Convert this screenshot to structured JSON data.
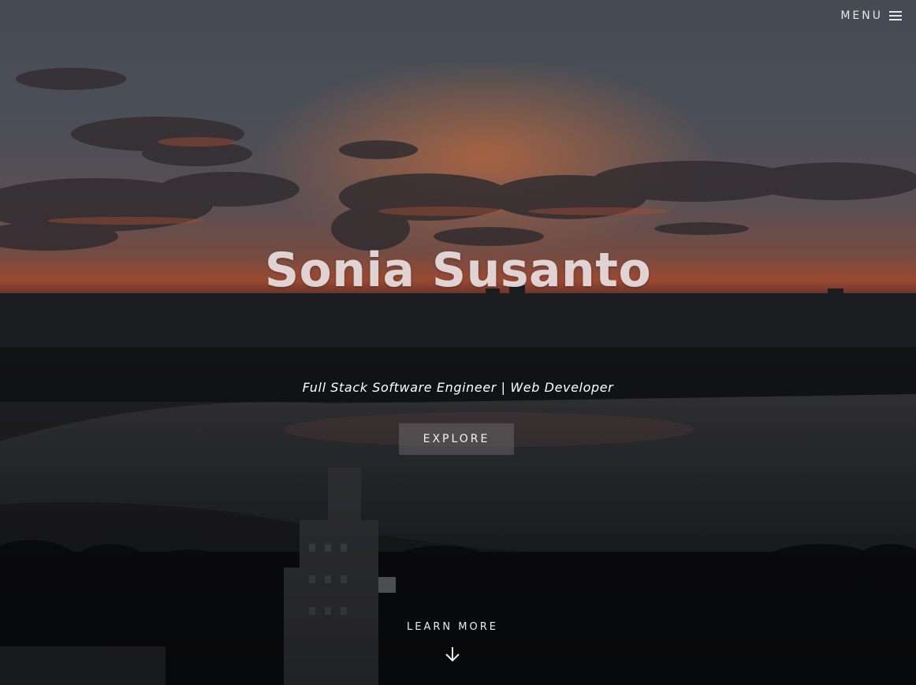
{
  "header": {
    "menu_label": "MENU",
    "menu_icon": "hamburger-icon"
  },
  "hero": {
    "title": "Sonia Susanto",
    "subtitle": "Full Stack Software Engineer | Web Developer",
    "explore_label": "EXPLORE",
    "learn_more_label": "LEARN MORE",
    "learn_more_icon": "arrow-down-icon",
    "background": "city-sunset-lake-photo"
  },
  "colors": {
    "title": "#efe6ea",
    "text": "#ffffff",
    "button_bg": "#6e6e72",
    "sky_top": "#4f555f",
    "sunset": "#e0653c"
  }
}
